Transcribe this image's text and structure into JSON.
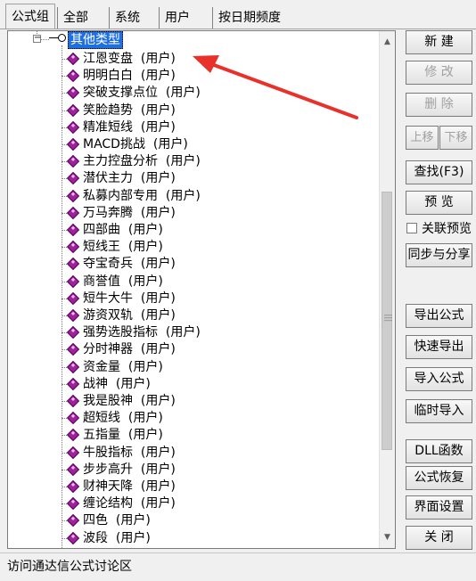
{
  "tabs": [
    {
      "label": "公式组",
      "active": true
    },
    {
      "label": "全部",
      "active": false
    },
    {
      "label": "系统",
      "active": false
    },
    {
      "label": "用户",
      "active": false
    },
    {
      "label": "按日期频度",
      "active": false
    }
  ],
  "tree": {
    "expander": "−",
    "root_label": "其他类型",
    "items": [
      "江恩变盘  (用户)",
      "明明白白  (用户)",
      "突破支撑点位  (用户)",
      "笑脸趋势  (用户)",
      "精准短线  (用户)",
      "MACD挑战  (用户)",
      "主力控盘分析  (用户)",
      "潜伏主力  (用户)",
      "私募内部专用  (用户)",
      "万马奔腾  (用户)",
      "四部曲  (用户)",
      "短线王  (用户)",
      "夺宝奇兵  (用户)",
      "商誉值  (用户)",
      "短牛大牛  (用户)",
      "游资双轨  (用户)",
      "强势选股指标  (用户)",
      "分时神器  (用户)",
      "资金量  (用户)",
      "战神  (用户)",
      "我是股神  (用户)",
      "超短线  (用户)",
      "五指量  (用户)",
      "牛股指标  (用户)",
      "步步高升  (用户)",
      "财神天降  (用户)",
      "缠论结构  (用户)",
      "四色  (用户)",
      "波段  (用户)"
    ]
  },
  "buttons": {
    "new": "新  建",
    "modify": "修  改",
    "delete": "删  除",
    "move_up": "上移",
    "move_down": "下移",
    "find": "查找(F3)",
    "preview": "预  览",
    "link_preview": "关联预览",
    "sync_share": "同步与分享",
    "export": "导出公式",
    "quick_export": "快速导出",
    "import": "导入公式",
    "temp_import": "临时导入",
    "dll": "DLL函数",
    "restore": "公式恢复",
    "ui_settings": "界面设置",
    "close": "关  闭"
  },
  "status_text": "访问通达信公式讨论区",
  "colors": {
    "selection": "#1e6fe0",
    "item_icon": "#a020a0",
    "annotation_arrow": "#e8312a"
  }
}
